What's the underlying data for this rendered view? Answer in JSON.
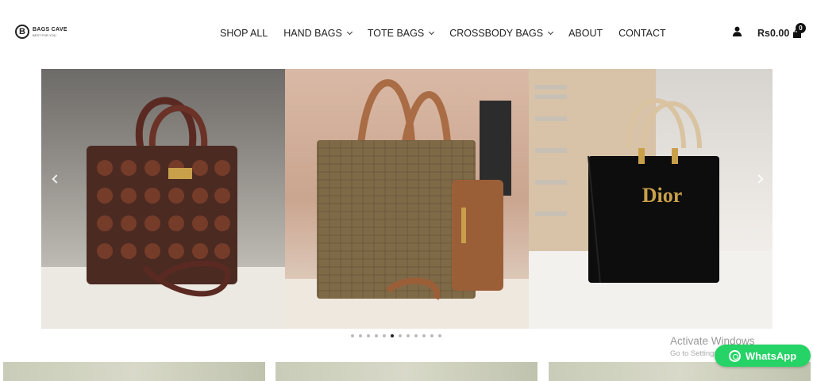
{
  "brand": {
    "logo_letter": "B",
    "name": "BAGS CAVE",
    "tagline": "BEST FOR YOU"
  },
  "nav": {
    "items": [
      {
        "label": "SHOP ALL",
        "has_dropdown": false
      },
      {
        "label": "HAND BAGS",
        "has_dropdown": true
      },
      {
        "label": "TOTE BAGS",
        "has_dropdown": true
      },
      {
        "label": "CROSSBODY BAGS",
        "has_dropdown": true
      },
      {
        "label": "ABOUT",
        "has_dropdown": false
      },
      {
        "label": "CONTACT",
        "has_dropdown": false
      }
    ]
  },
  "header": {
    "user_icon": "user-icon",
    "cart_total": "Rs0.00",
    "cart_icon": "shopping-bag-icon",
    "cart_count": "0"
  },
  "slider": {
    "slide_count": 12,
    "active_index": 5,
    "slides": [
      {
        "name": "coach-monogram-handbag",
        "main_color": "#5b2d23"
      },
      {
        "name": "olive-croc-tote-with-pouch",
        "main_color": "#8a6a3f"
      },
      {
        "name": "black-patent-dior-handbag",
        "main_color": "#111111"
      }
    ]
  },
  "overlay": {
    "activate_title": "Activate Windows",
    "activate_sub": "Go to Settings"
  },
  "whatsapp": {
    "label": "WhatsApp",
    "color": "#25d366"
  }
}
